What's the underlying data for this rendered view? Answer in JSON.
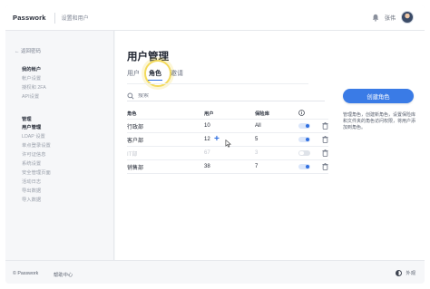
{
  "header": {
    "brand": "Passwork",
    "breadcrumb": "设置和用户",
    "user_name": "张伟"
  },
  "sidebar": {
    "back_label": "← 返回密码",
    "groups": [
      {
        "title": "我的帐户",
        "items": [
          "帐户设置",
          "授权和 2FA",
          "API设置"
        ]
      },
      {
        "title": "管理",
        "items": [
          "用户管理",
          "LDAP 设置",
          "单点登录设置",
          "许可证信息",
          "系统设置",
          "安全管理页面",
          "活动日志",
          "导出数据",
          "导入数据"
        ]
      }
    ],
    "active_item": "用户管理"
  },
  "main": {
    "title": "用户管理",
    "tabs": [
      "用户",
      "角色",
      "邀请"
    ],
    "active_tab": "角色",
    "search_placeholder": "搜索",
    "columns": [
      "角色",
      "用户",
      "保险库",
      ""
    ],
    "rows": [
      {
        "role": "行政部",
        "users": "10",
        "vaults": "All",
        "enabled": true,
        "disabled_row": false
      },
      {
        "role": "客户部",
        "users": "12",
        "vaults": "5",
        "enabled": true,
        "disabled_row": false
      },
      {
        "role": "IT部",
        "users": "67",
        "vaults": "3",
        "enabled": false,
        "disabled_row": true
      },
      {
        "role": "销售部",
        "users": "38",
        "vaults": "7",
        "enabled": true,
        "disabled_row": false
      }
    ],
    "create_button": "创建角色",
    "description": "管理角色，创建新角色，设置保险库和文件夹的角色访问权限，将用户添加到角色。"
  },
  "footer": {
    "copyright": "© Passwork",
    "help": "帮助中心",
    "theme_label": "外观"
  },
  "colors": {
    "accent": "#3a7be6",
    "highlight_ring": "#f3da5b"
  },
  "icons": [
    "bell-icon",
    "avatar",
    "search-icon",
    "info-icon",
    "trash-icon",
    "plus-icon",
    "cursor-icon",
    "theme-toggle-icon"
  ]
}
